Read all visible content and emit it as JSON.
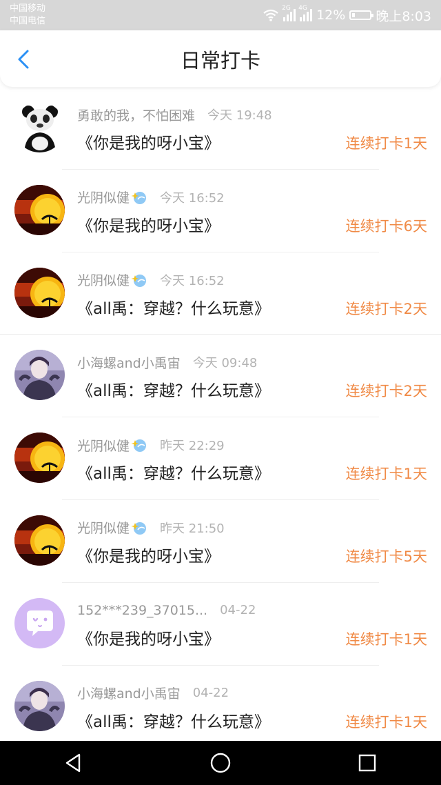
{
  "status_bar": {
    "carrier_1": "中国移动",
    "carrier_2": "中国电信",
    "net_1": "2G",
    "net_2": "4G",
    "battery": "12%",
    "time": "晚上8:03"
  },
  "header": {
    "title": "日常打卡"
  },
  "colors": {
    "accent": "#2a90f5",
    "streak": "#f08a46",
    "name": "#999999",
    "title": "#222222"
  },
  "checkins": [
    {
      "avatar": "panda-avatar",
      "name": "勇敢的我，不怕困难",
      "badge": false,
      "time": "今天 19:48",
      "book": "《你是我的呀小宝》",
      "streak": "连续打卡1天"
    },
    {
      "avatar": "sunset-avatar",
      "name": "光阴似健",
      "badge": true,
      "time": "今天 16:52",
      "book": "《你是我的呀小宝》",
      "streak": "连续打卡6天"
    },
    {
      "avatar": "sunset-avatar",
      "name": "光阴似健",
      "badge": true,
      "time": "今天 16:52",
      "book": "《all禹：穿越？什么玩意》",
      "streak": "连续打卡2天"
    },
    {
      "avatar": "person-avatar",
      "name": "小海螺and小禹宙",
      "badge": false,
      "time": "今天 09:48",
      "book": "《all禹：穿越？什么玩意》",
      "streak": "连续打卡2天"
    },
    {
      "avatar": "sunset-avatar",
      "name": "光阴似健",
      "badge": true,
      "time": "昨天 22:29",
      "book": "《all禹：穿越？什么玩意》",
      "streak": "连续打卡1天"
    },
    {
      "avatar": "sunset-avatar",
      "name": "光阴似健",
      "badge": true,
      "time": "昨天 21:50",
      "book": "《你是我的呀小宝》",
      "streak": "连续打卡5天"
    },
    {
      "avatar": "default-chat-avatar",
      "name": "152***239_37015...",
      "badge": false,
      "time": "04-22",
      "book": "《你是我的呀小宝》",
      "streak": "连续打卡1天"
    },
    {
      "avatar": "person-avatar",
      "name": "小海螺and小禹宙",
      "badge": false,
      "time": "04-22",
      "book": "《all禹：穿越？什么玩意》",
      "streak": "连续打卡1天"
    }
  ]
}
